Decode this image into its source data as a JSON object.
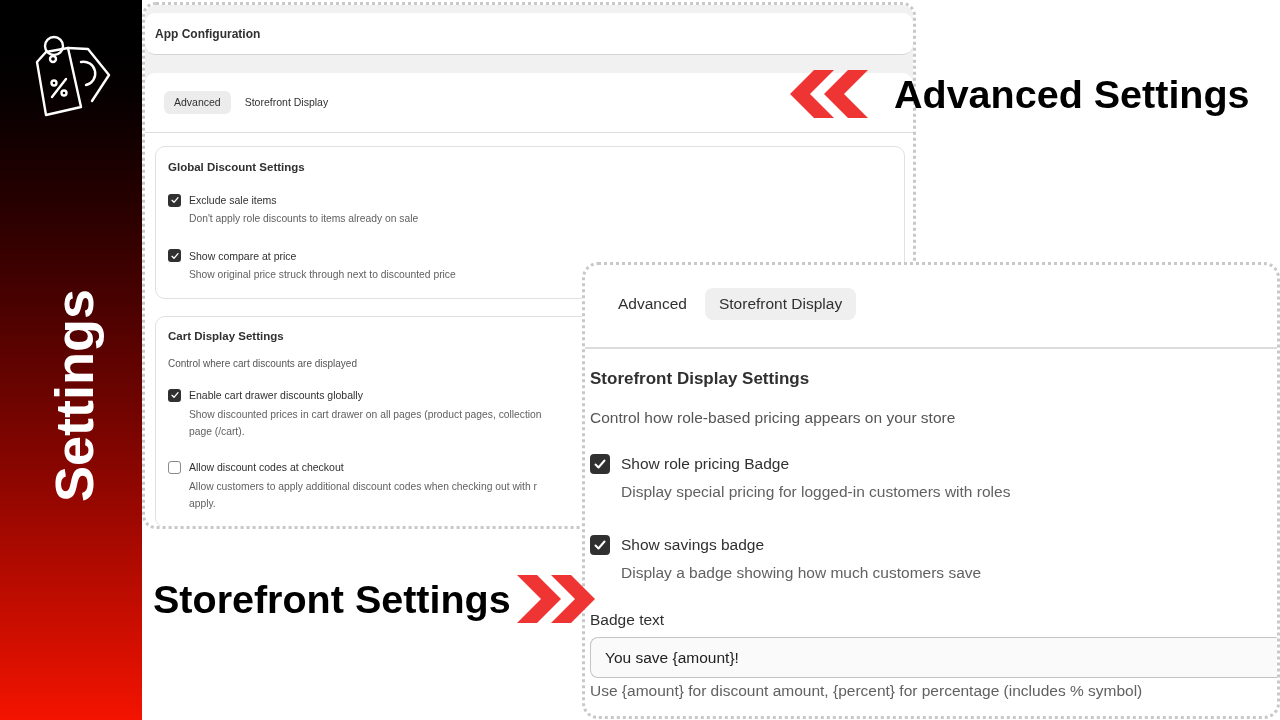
{
  "sidebar": {
    "title": "Settings"
  },
  "advanced_screenshot": {
    "header": {
      "title": "App Configuration"
    },
    "tabs": [
      {
        "label": "Advanced",
        "selected": true
      },
      {
        "label": "Storefront Display",
        "selected": false
      }
    ],
    "sections": [
      {
        "title": "Global Discount Settings",
        "options": [
          {
            "label": "Exclude sale items",
            "checked": true,
            "description_lines": [
              "Don't apply role discounts to items already on sale"
            ]
          },
          {
            "label": "Show compare at price",
            "checked": true,
            "description_lines": [
              "Show original price struck through next to discounted price"
            ]
          }
        ]
      },
      {
        "title": "Cart Display Settings",
        "description": "Control where cart discounts are displayed",
        "options": [
          {
            "label": "Enable cart drawer discounts globally",
            "checked": true,
            "description_lines": [
              "Show discounted prices in cart drawer on all pages (product pages, collection",
              "page (/cart)."
            ]
          },
          {
            "label": "Allow discount codes at checkout",
            "checked": false,
            "description_lines": [
              "Allow customers to apply additional discount codes when checking out with r",
              "apply."
            ]
          }
        ]
      }
    ]
  },
  "storefront_screenshot": {
    "tabs": [
      {
        "label": "Advanced",
        "selected": false
      },
      {
        "label": "Storefront Display",
        "selected": true
      }
    ],
    "section": {
      "title": "Storefront Display Settings",
      "description": "Control how role-based pricing appears on your store",
      "options": [
        {
          "label": "Show role pricing Badge",
          "checked": true,
          "description": "Display special pricing for logged-in customers with roles"
        },
        {
          "label": "Show savings badge",
          "checked": true,
          "description": "Display a badge showing how much customers save"
        }
      ],
      "badge_text": {
        "label": "Badge text",
        "value": "You save {amount}!",
        "help": "Use {amount} for discount amount, {percent} for percentage (includes % symbol)"
      }
    }
  },
  "callouts": [
    {
      "text": "Advanced Settings",
      "kind": "leftarrow"
    },
    {
      "text": "Storefront Settings",
      "kind": "rightarrow"
    }
  ]
}
